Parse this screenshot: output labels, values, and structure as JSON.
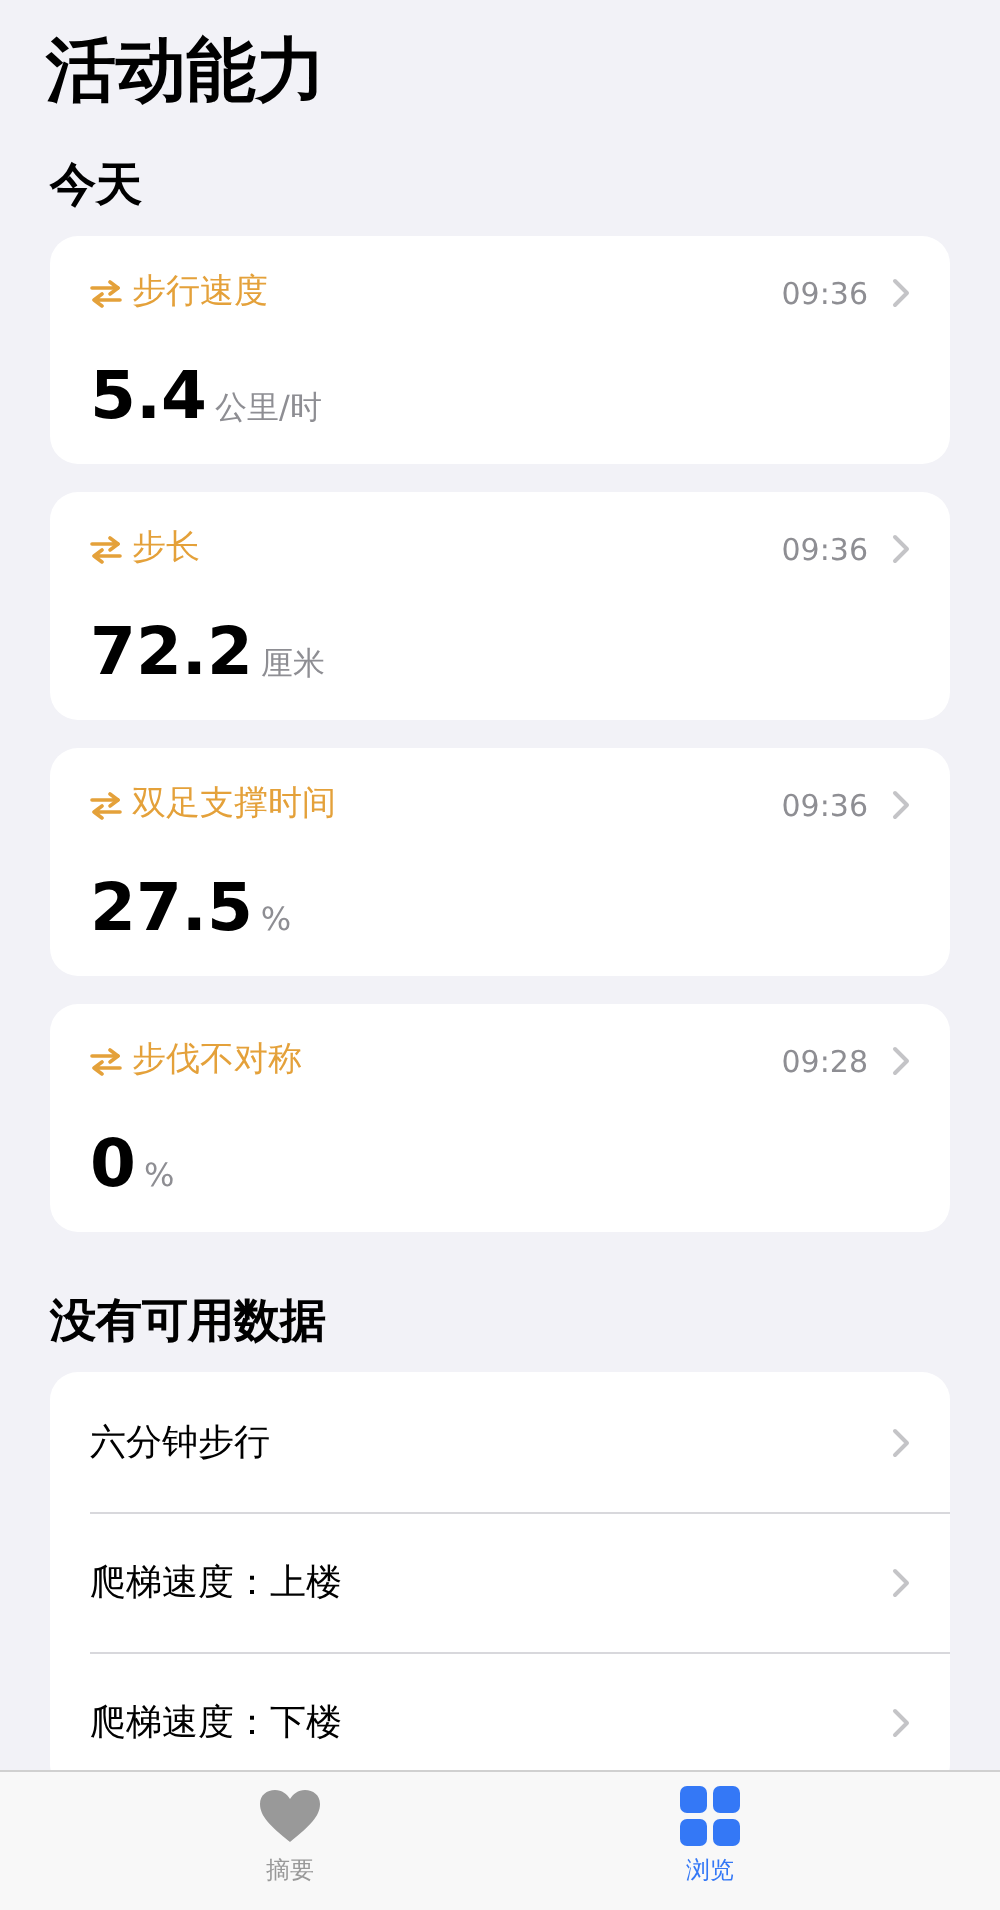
{
  "title": "活动能力",
  "today": {
    "heading": "今天",
    "metrics": [
      {
        "label": "步行速度",
        "time": "09:36",
        "value": "5.4",
        "unit": "公里/时"
      },
      {
        "label": "步长",
        "time": "09:36",
        "value": "72.2",
        "unit": "厘米"
      },
      {
        "label": "双足支撑时间",
        "time": "09:36",
        "value": "27.5",
        "unit": "%"
      },
      {
        "label": "步伐不对称",
        "time": "09:28",
        "value": "0",
        "unit": "%"
      }
    ]
  },
  "no_data": {
    "heading": "没有可用数据",
    "items": [
      "六分钟步行",
      "爬梯速度：上楼",
      "爬梯速度：下楼"
    ]
  },
  "tab_bar": [
    {
      "label": "摘要",
      "kind": "heart",
      "selected": false
    },
    {
      "label": "浏览",
      "kind": "grid",
      "selected": true
    }
  ]
}
